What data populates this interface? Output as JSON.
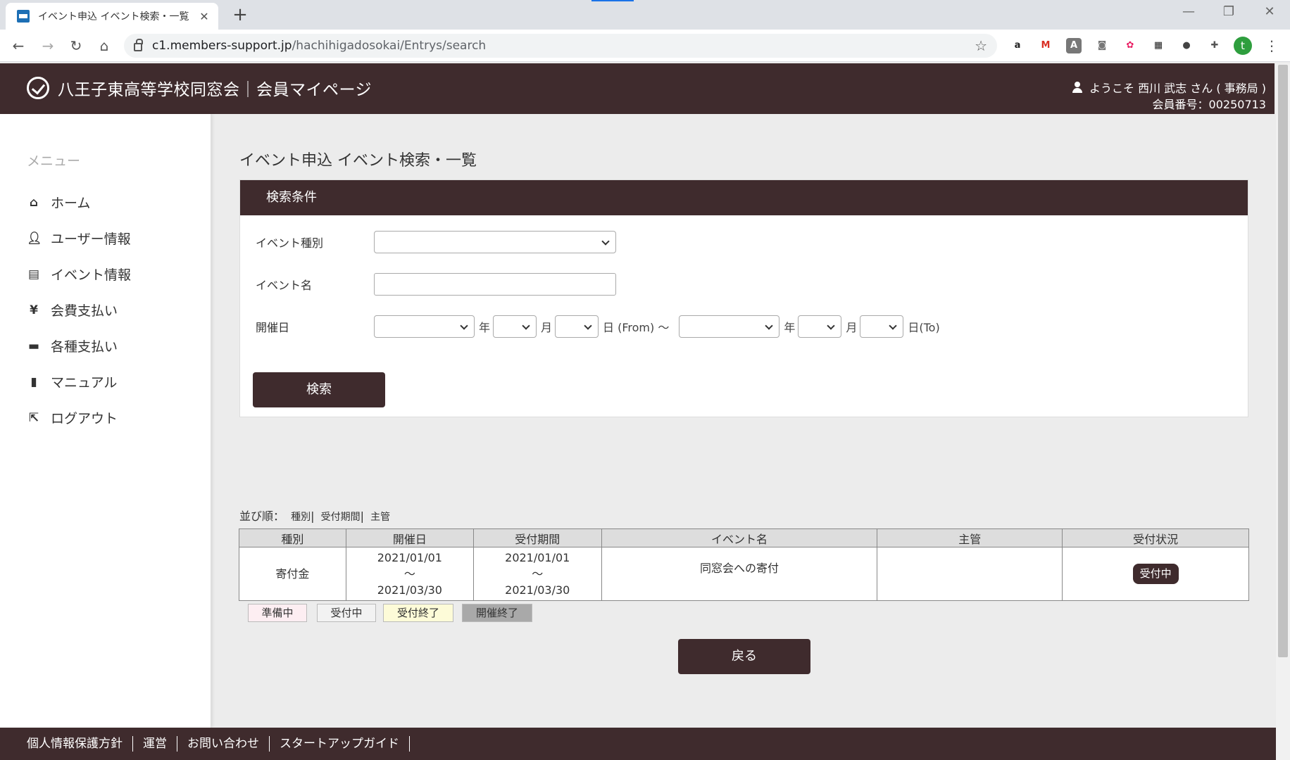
{
  "browser": {
    "tab_title": "イベント申込 イベント検索・一覧",
    "url_host": "c1.members-support.jp",
    "url_path": "/hachihigadosokai/Entrys/search",
    "profile_initial": "t"
  },
  "header": {
    "site_title": "八王子東高等学校同窓会｜会員マイページ",
    "welcome": "ようこそ 西川 武志 さん ( 事務局 )",
    "member_no": "会員番号：00250713"
  },
  "sidebar": {
    "title": "メニュー",
    "items": [
      {
        "label": "ホーム",
        "icon": "home-icon"
      },
      {
        "label": "ユーザー情報",
        "icon": "user-icon"
      },
      {
        "label": "イベント情報",
        "icon": "list-icon"
      },
      {
        "label": "会費支払い",
        "icon": "yen-icon"
      },
      {
        "label": "各種支払い",
        "icon": "card-icon"
      },
      {
        "label": "マニュアル",
        "icon": "book-icon"
      },
      {
        "label": "ログアウト",
        "icon": "logout-icon"
      }
    ]
  },
  "main": {
    "page_title": "イベント申込 イベント検索・一覧",
    "panel_title": "検索条件",
    "event_type_label": "イベント種別",
    "event_name_label": "イベント名",
    "date_label": "開催日",
    "year": "年",
    "month": "月",
    "day_from": "日 (From) ～",
    "day_to": "日(To)",
    "search_button": "検索",
    "sort_label": "並び順：",
    "sort_type": "種別",
    "sort_period": "受付期間",
    "sort_org": "主管",
    "table": {
      "headers": [
        "種別",
        "開催日",
        "受付期間",
        "イベント名",
        "主管",
        "受付状況"
      ],
      "rows": [
        {
          "type": "寄付金",
          "date_from": "2021/01/01",
          "date_sep": "～",
          "date_to": "2021/03/30",
          "period_from": "2021/01/01",
          "period_sep": "～",
          "period_to": "2021/03/30",
          "name": "同窓会への寄付",
          "org": "",
          "status": "受付中"
        }
      ]
    },
    "legend": [
      {
        "label": "準備中",
        "bg": "#fdeef2"
      },
      {
        "label": "受付中",
        "bg": "#f2f2f2"
      },
      {
        "label": "受付終了",
        "bg": "#fdfbd8"
      },
      {
        "label": "開催終了",
        "bg": "#a9a9a9"
      }
    ],
    "back_button": "戻る"
  },
  "footer": {
    "links": [
      "個人情報保護方針",
      "運営",
      "お問い合わせ",
      "スタートアップガイド"
    ]
  },
  "colors": {
    "brand": "#3f2b2d"
  }
}
